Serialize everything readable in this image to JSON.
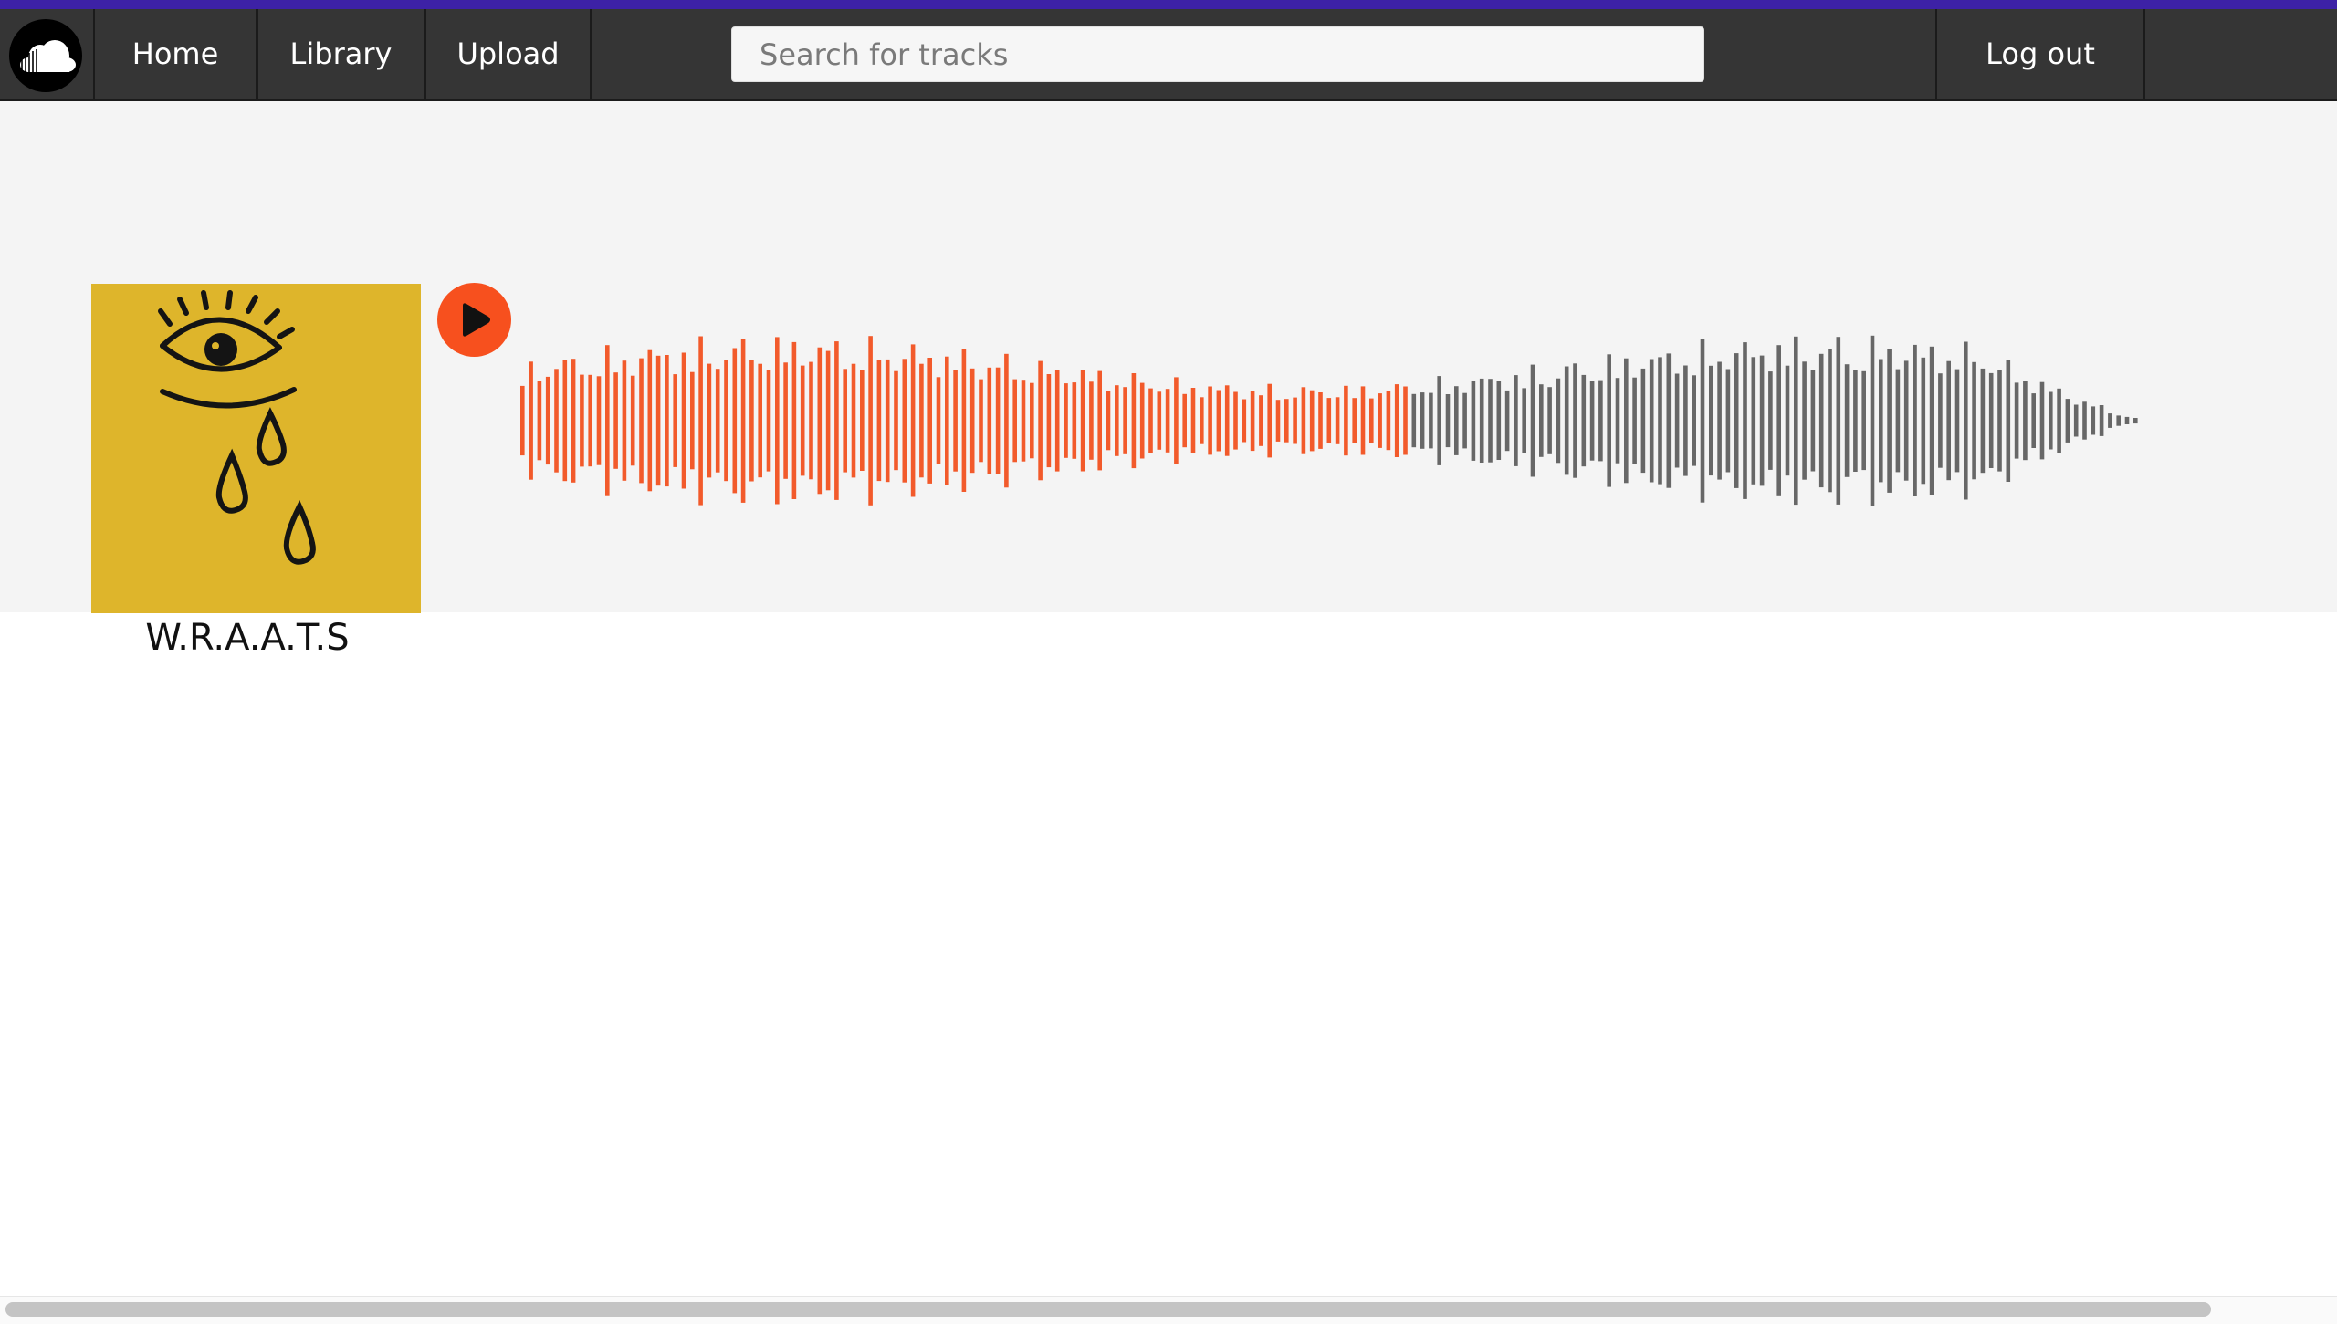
{
  "nav": {
    "logo": "soundcloud-cloud-icon",
    "home": "Home",
    "library": "Library",
    "upload": "Upload",
    "logout": "Log out"
  },
  "search": {
    "placeholder": "Search for tracks"
  },
  "track": {
    "title": "W.R.A.A.T.S",
    "cover_art": "crying-eye-drawing",
    "play_icon": "play-icon",
    "progress": 0.545
  },
  "colors": {
    "accent": "#f7501e",
    "played": "#f25a2b",
    "unplayed": "#676767",
    "navbar": "#353535",
    "topline": "#3d21a6",
    "cover": "#deb52b"
  }
}
